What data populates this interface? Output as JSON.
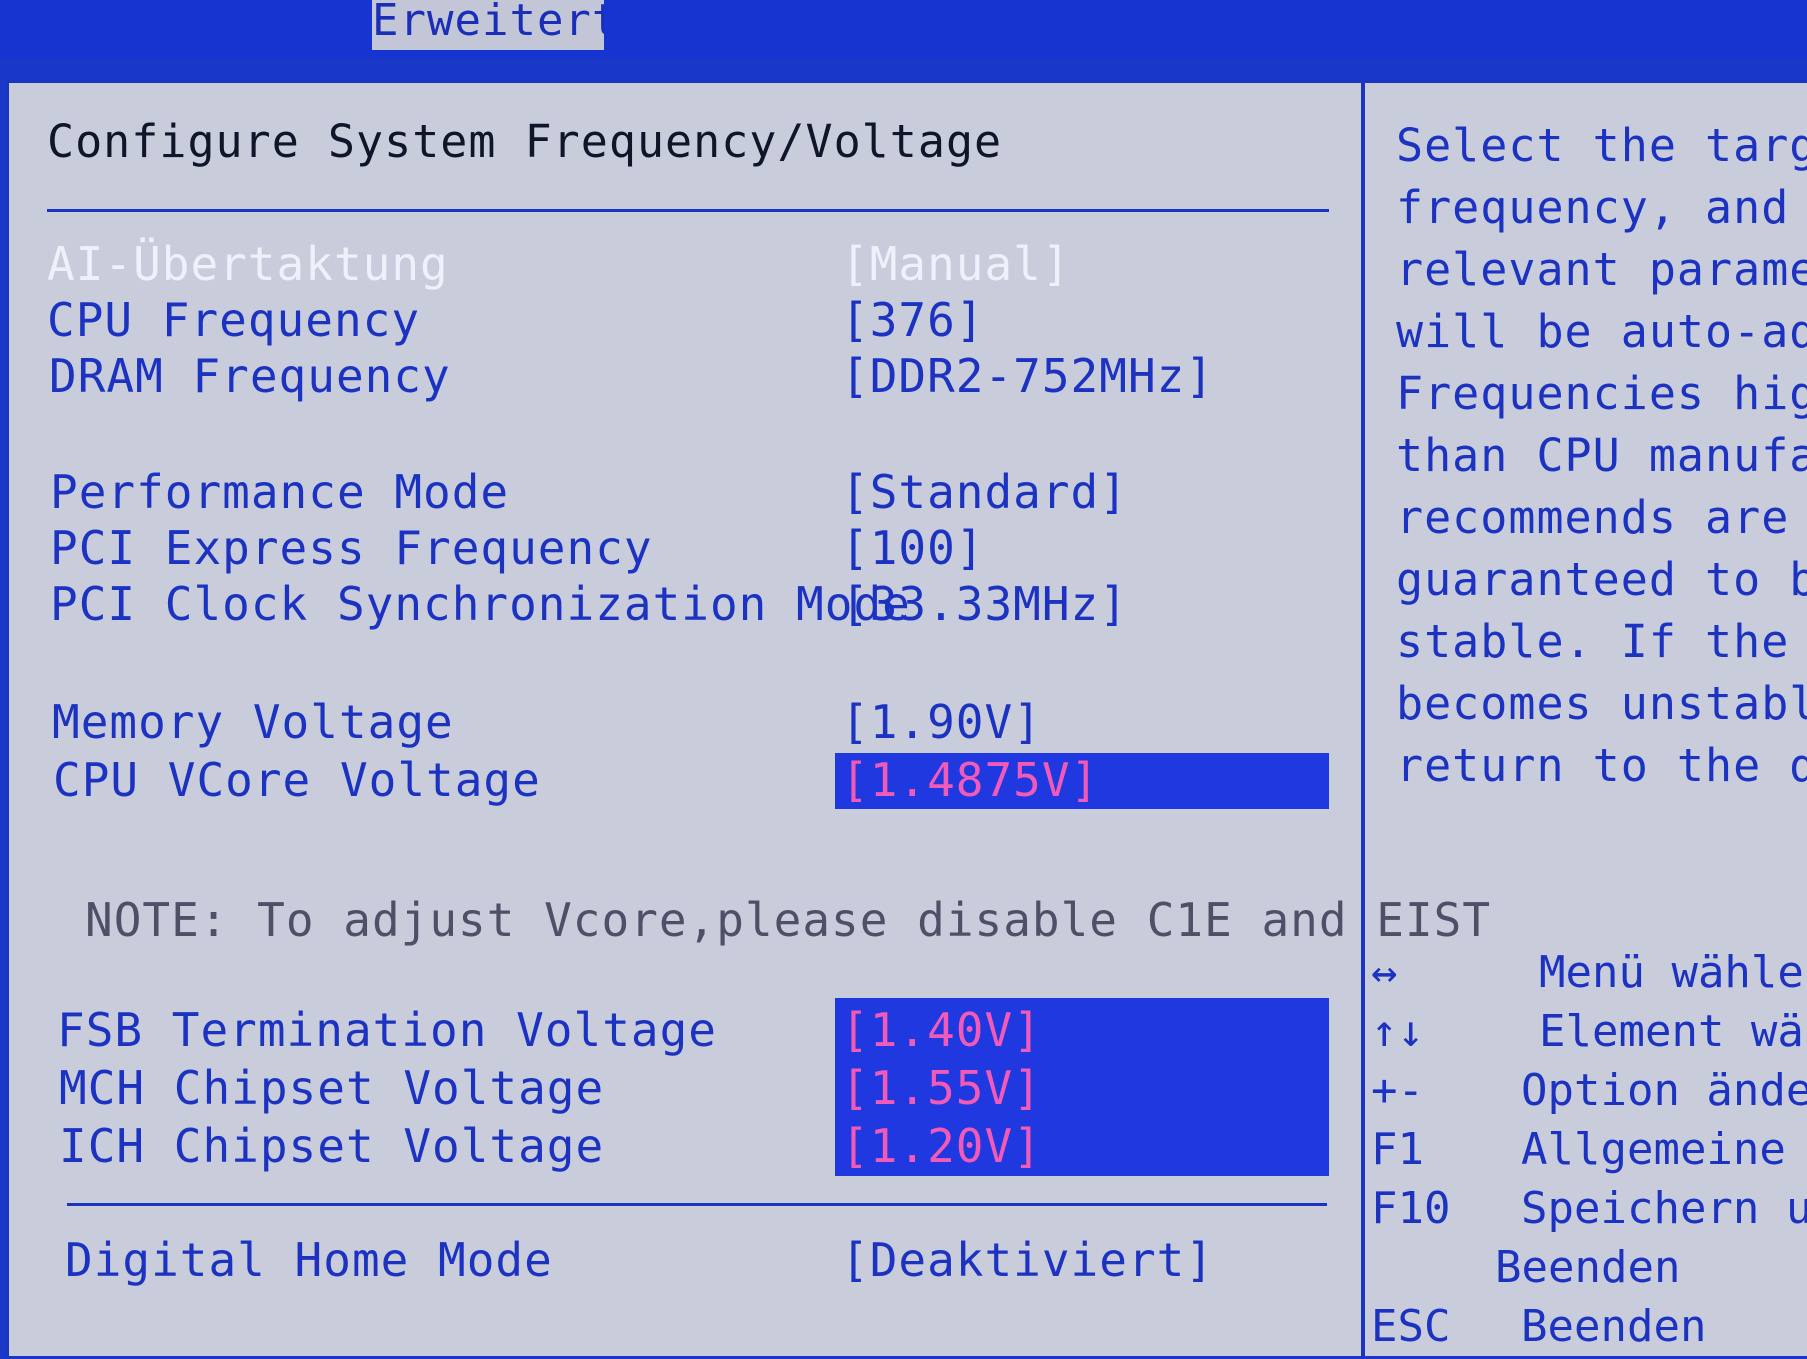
{
  "header": {
    "active_tab": "Erweitert"
  },
  "main": {
    "title": "Configure System Frequency/Voltage",
    "settings": [
      {
        "label": "AI-Übertaktung",
        "value": "[Manual]"
      },
      {
        "label": "CPU Frequency",
        "value": "[376]"
      },
      {
        "label": "DRAM Frequency",
        "value": "[DDR2-752MHz]"
      },
      {
        "label": "Performance Mode",
        "value": "[Standard]"
      },
      {
        "label": "PCI Express Frequency",
        "value": "[100]"
      },
      {
        "label": "PCI Clock Synchronization Mode",
        "value": "[33.33MHz]"
      },
      {
        "label": "Memory Voltage",
        "value": "[1.90V]"
      },
      {
        "label": "CPU VCore Voltage",
        "value": "[1.4875V]"
      },
      {
        "label": "FSB Termination Voltage",
        "value": "[1.40V]"
      },
      {
        "label": "MCH Chipset Voltage",
        "value": "[1.55V]"
      },
      {
        "label": "ICH Chipset Voltage",
        "value": "[1.20V]"
      },
      {
        "label": "Digital Home Mode",
        "value": "[Deaktiviert]"
      }
    ],
    "note": "NOTE:  To adjust Vcore,please disable C1E and EIST"
  },
  "help": {
    "lines": [
      "Select the target",
      "frequency, and the",
      "relevant parameter",
      "will be auto-adjus",
      "Frequencies higher",
      "than CPU manufactu",
      "recommends are not",
      "guaranteed to be",
      "stable. If the sys",
      "becomes unstable,",
      "return to the defa"
    ]
  },
  "keys": [
    {
      "key": "↔",
      "desc": "Menü wählen"
    },
    {
      "key": "↑↓",
      "desc": "Element wähl"
    },
    {
      "key": "+-",
      "desc": "Option ändern"
    },
    {
      "key": "F1",
      "desc": "Allgemeine Hi"
    },
    {
      "key": "F10",
      "desc": "Speichern und"
    },
    {
      "key": "",
      "desc": "Beenden"
    },
    {
      "key": "ESC",
      "desc": "Beenden"
    }
  ],
  "colors": {
    "background": "#c9ccdb",
    "accent_blue": "#1c33c2",
    "highlight_fill": "#1f38e0",
    "highlight_text": "#f25ab8",
    "dim_text": "#eef0fa"
  }
}
